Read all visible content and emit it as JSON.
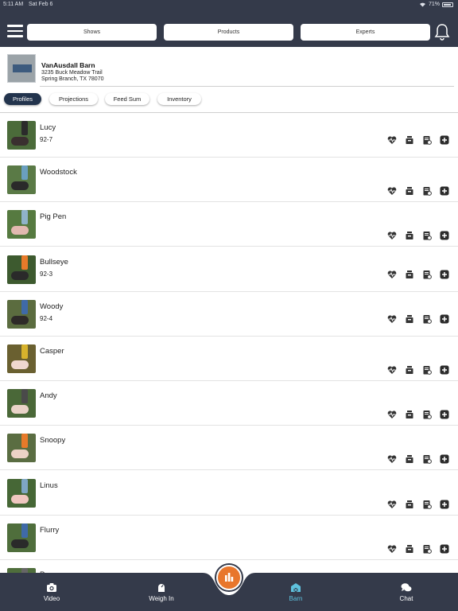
{
  "status_bar": {
    "time": "5:11 AM",
    "date": "Sat Feb 6",
    "battery": "71%"
  },
  "top_nav": {
    "shows": "Shows",
    "products": "Products",
    "experts": "Experts"
  },
  "barn": {
    "name": "VanAusdall Barn",
    "address_line1": "3235 Buck Meadow Trail",
    "address_line2": "Spring Branch, TX 78070"
  },
  "tabs": [
    "Profiles",
    "Projections",
    "Feed Sum",
    "Inventory"
  ],
  "active_tab": "Profiles",
  "animals": [
    {
      "name": "Lucy",
      "tag": "92-7"
    },
    {
      "name": "Woodstock",
      "tag": ""
    },
    {
      "name": "Pig Pen",
      "tag": ""
    },
    {
      "name": "Bullseye",
      "tag": "92-3"
    },
    {
      "name": "Woody",
      "tag": "92-4"
    },
    {
      "name": "Casper",
      "tag": ""
    },
    {
      "name": "Andy",
      "tag": ""
    },
    {
      "name": "Snoopy",
      "tag": ""
    },
    {
      "name": "Linus",
      "tag": ""
    },
    {
      "name": "Flurry",
      "tag": ""
    },
    {
      "name": "P...",
      "tag": ""
    }
  ],
  "action_icons": [
    "heartbeat-icon",
    "feed-bowl-icon",
    "clipboard-icon",
    "add-icon"
  ],
  "bottom_nav": {
    "video": "Video",
    "weigh_in": "Weigh In",
    "barn": "Barn",
    "chat": "Chat"
  },
  "colors": {
    "nav_dark": "#343a4a",
    "active_tab": "#23344d",
    "accent_teal": "#5fc2de",
    "fab_orange": "#e8762c"
  }
}
